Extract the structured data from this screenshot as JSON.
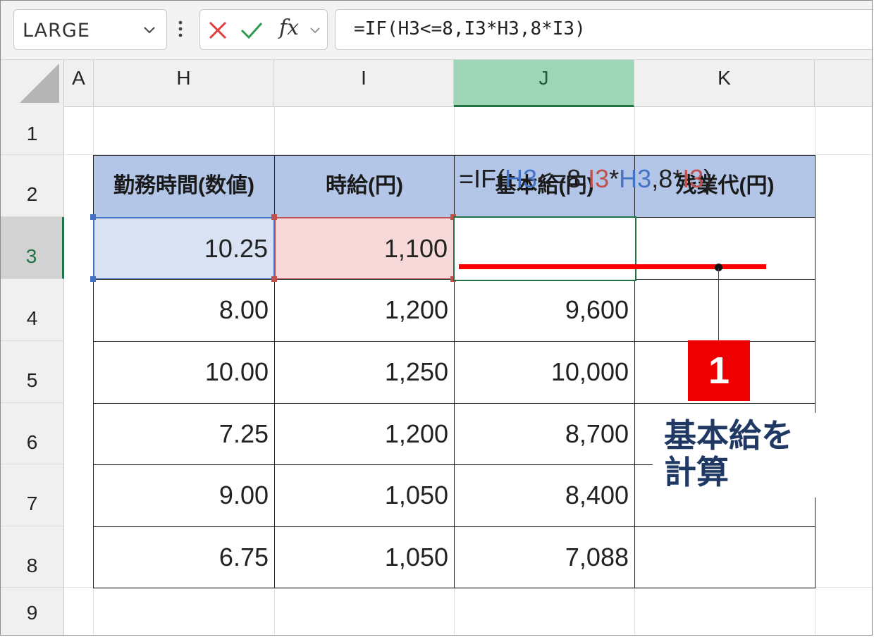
{
  "formula_bar": {
    "name_box": "LARGE",
    "fx_label": "fx",
    "formula": "=IF(H3<=8,I3*H3,8*I3)"
  },
  "columns": [
    "A",
    "H",
    "I",
    "J",
    "K"
  ],
  "rows": [
    "1",
    "2",
    "3",
    "4",
    "5",
    "6",
    "7",
    "8",
    "9"
  ],
  "table": {
    "headers": [
      "勤務時間(数値)",
      "時給(円)",
      "基本給(円)",
      "残業代(円)"
    ],
    "rows": [
      [
        "10.25",
        "1,100",
        "",
        ""
      ],
      [
        "8.00",
        "1,200",
        "9,600",
        ""
      ],
      [
        "10.00",
        "1,250",
        "10,000",
        ""
      ],
      [
        "7.25",
        "1,200",
        "8,700",
        ""
      ],
      [
        "9.00",
        "1,050",
        "8,400",
        ""
      ],
      [
        "6.75",
        "1,050",
        "7,088",
        ""
      ]
    ]
  },
  "edit_formula": {
    "p1": "=IF(",
    "ref1": "H3",
    "p2": "<=8,",
    "ref2": "I3",
    "p3": "*",
    "ref3": "H3",
    "p4": ",8*",
    "ref4": "I3",
    "p5": ")"
  },
  "annotation": {
    "badge": "1",
    "callout": "基本給を\n計算"
  },
  "colors": {
    "header_fill": "#b4c6e7",
    "ref_blue": "#4472c4",
    "ref_red": "#c0504d",
    "active_green": "#217346",
    "badge_red": "#ee0000",
    "callout_navy": "#1f3864"
  }
}
